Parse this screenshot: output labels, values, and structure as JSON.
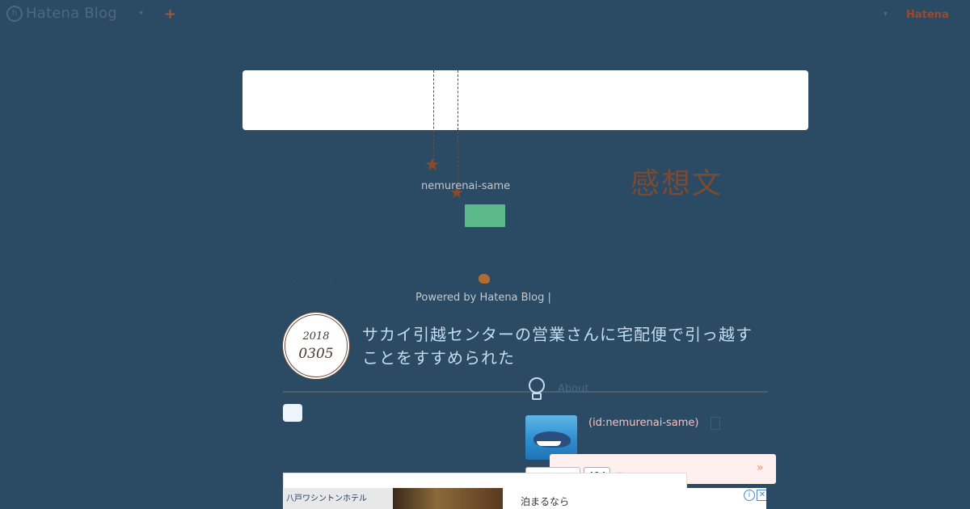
{
  "topbar": {
    "logo_text": "Hatena Blog",
    "logo_mark": "h",
    "plus_symbol": "+",
    "dropdown_arrow": "▾",
    "right_dropdown_arrow": "▾",
    "hatena_text": "Hatena"
  },
  "header": {
    "blog_id": "nemurenai-same",
    "blog_title": "感想文",
    "star_symbol": "★",
    "powered_by": "Powered by Hatena Blog |"
  },
  "entry": {
    "date_year": "2018",
    "date_monthday": "0305",
    "title": "サカイ引越センターの営業さんに宅配便で引っ越すことをすすめられた"
  },
  "profile": {
    "user_id": "(id:nemurenai-same)",
    "readers_count": "494",
    "more_arrow": "»",
    "about_label": "About"
  },
  "ad": {
    "hotel_name": "八戸ワシントンホテル",
    "text": "泊まるなら",
    "info_symbol": "i",
    "close_symbol": "✕"
  },
  "colors": {
    "background": "#2b4a64",
    "accent_green": "#5bb98a",
    "title_brown": "#7a4a32",
    "entry_title_blue": "#c6dcee",
    "user_id_pink": "#f0c4c4"
  }
}
